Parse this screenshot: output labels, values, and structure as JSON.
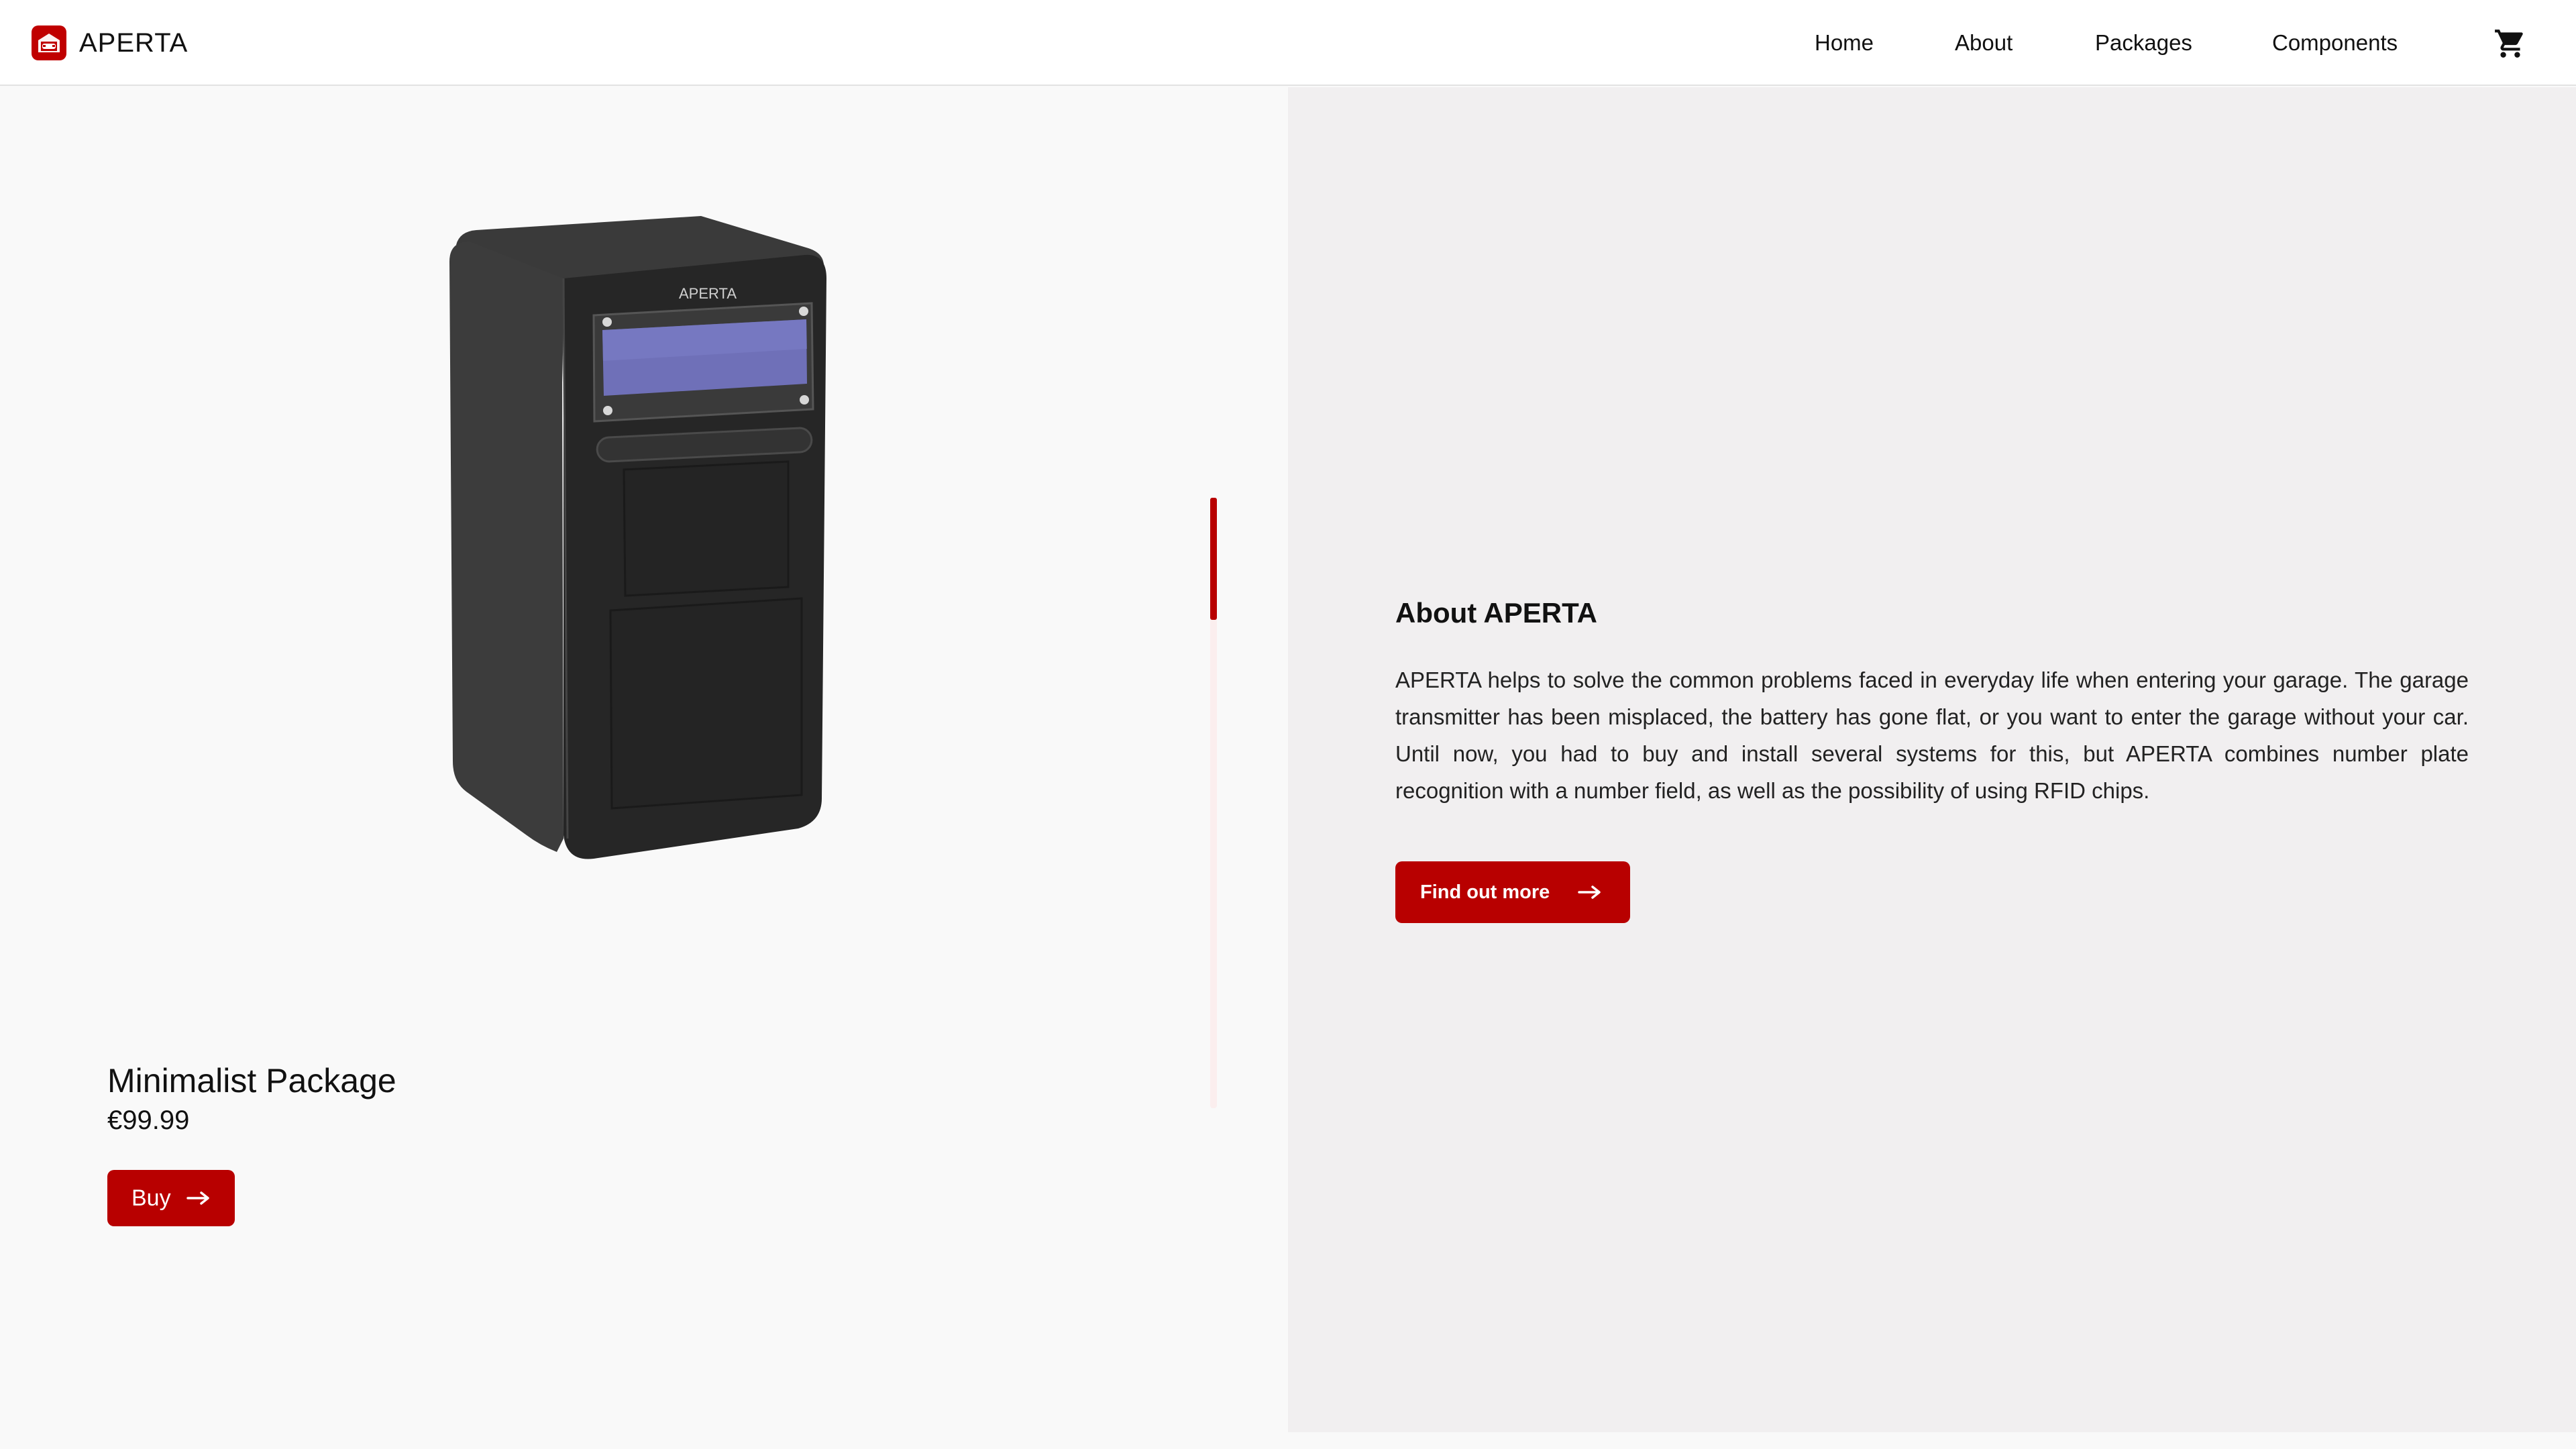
{
  "header": {
    "brand": "APERTA",
    "nav": [
      "Home",
      "About",
      "Packages",
      "Components"
    ],
    "cart_icon": "shopping-cart-icon",
    "logo_icon": "garage-car-logo-icon"
  },
  "slider": {
    "position_fraction": 0.0,
    "thumb_fraction": 0.2
  },
  "product": {
    "device_label": "APERTA",
    "title": "Minimalist Package",
    "price": "€99.99",
    "buy_label": "Buy",
    "buy_icon": "arrow-right-icon"
  },
  "about": {
    "title": "About APERTA",
    "text": "APERTA helps to solve the common problems faced in everyday life when entering your garage. The garage transmitter has been misplaced, the battery has gone flat, or you want to enter the garage without your car. Until now, you had to buy and install several systems for this, but APERTA combines number plate recognition with a number field, as well as the possibility of using RFID chips.",
    "button_label": "Find out more",
    "button_icon": "arrow-right-icon"
  },
  "colors": {
    "accent": "#b80000",
    "logo": "#c00000",
    "left_background": "#f9f9f9",
    "right_background": "#f1eff0",
    "device_body": "#2a2a2a",
    "display": "#6f70b8"
  }
}
